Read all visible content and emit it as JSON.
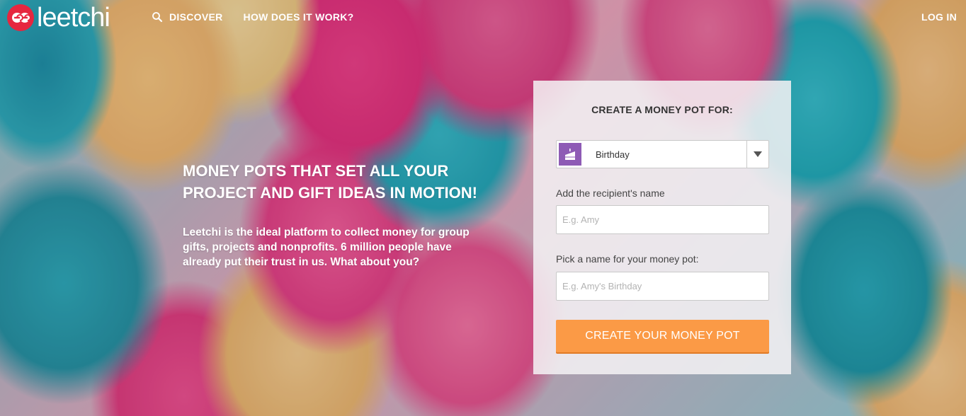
{
  "brand": {
    "name": "leetchi",
    "logo_icon": "leetchi-logo-icon",
    "accent": "#e6263f"
  },
  "nav": {
    "items": [
      {
        "label": "DISCOVER",
        "icon": "search-icon"
      },
      {
        "label": "HOW DOES IT WORK?"
      }
    ],
    "login_label": "LOG IN"
  },
  "hero": {
    "title": "MONEY POTS THAT SET ALL YOUR PROJECT AND GIFT IDEAS IN MOTION!",
    "body": "Leetchi is the ideal platform to collect money for group gifts, projects and nonprofits. 6 million people have already put their trust in us. What about you?"
  },
  "form": {
    "title": "CREATE A MONEY POT FOR:",
    "occasion": {
      "selected": "Birthday",
      "icon": "birthday-cake-icon",
      "icon_bg": "#8e5bb5"
    },
    "recipient_label": "Add the recipient's name",
    "recipient_placeholder": "E.g. Amy",
    "pot_name_label": "Pick a name for your money pot:",
    "pot_name_placeholder": "E.g. Amy's Birthday",
    "submit_label": "CREATE YOUR MONEY POT",
    "submit_color": "#fb9a46"
  }
}
